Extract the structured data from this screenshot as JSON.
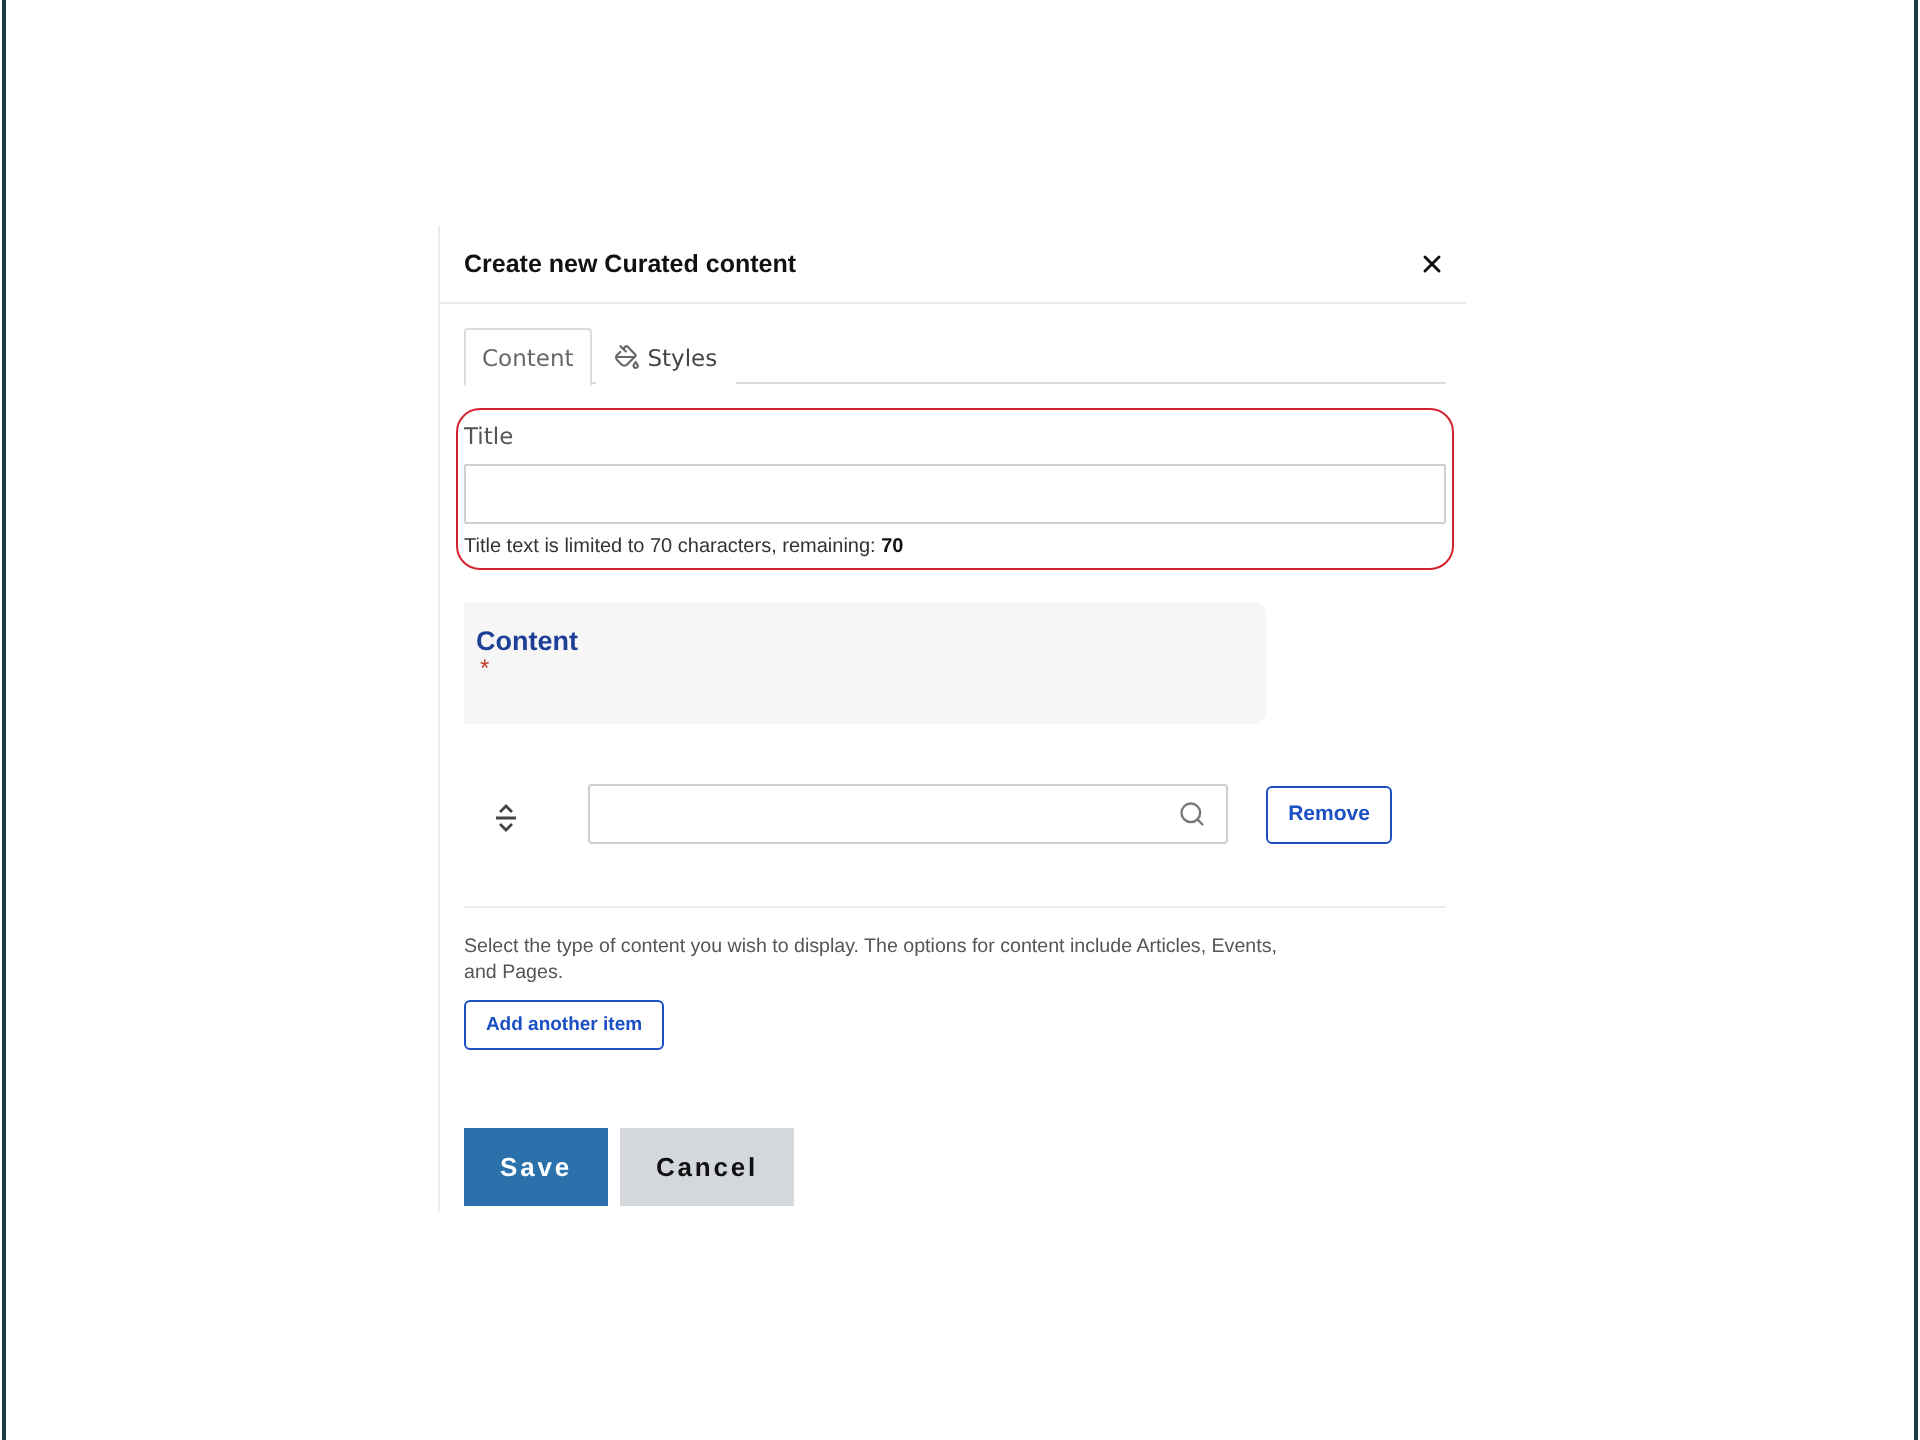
{
  "dialog": {
    "title": "Create new Curated content"
  },
  "tabs": [
    {
      "label": "Content",
      "selected": true,
      "icon": false
    },
    {
      "label": "Styles",
      "selected": false,
      "icon": true
    }
  ],
  "title_field": {
    "label": "Title",
    "highlighted": true,
    "help": "Title text is limited to 70 characters, remaining: **70**"
  },
  "content_section": {
    "heading": "Content",
    "required_mark": "*"
  },
  "items": [
    {
      "remove_label": "Remove"
    }
  ],
  "description": "Select the type of content you wish to display. The options for content include Articles, Events, and Pages.",
  "add_button": "Add another item",
  "actions": [
    {
      "label": "Save",
      "kind": "primary"
    },
    {
      "label": "Cancel",
      "kind": "secondary"
    }
  ]
}
